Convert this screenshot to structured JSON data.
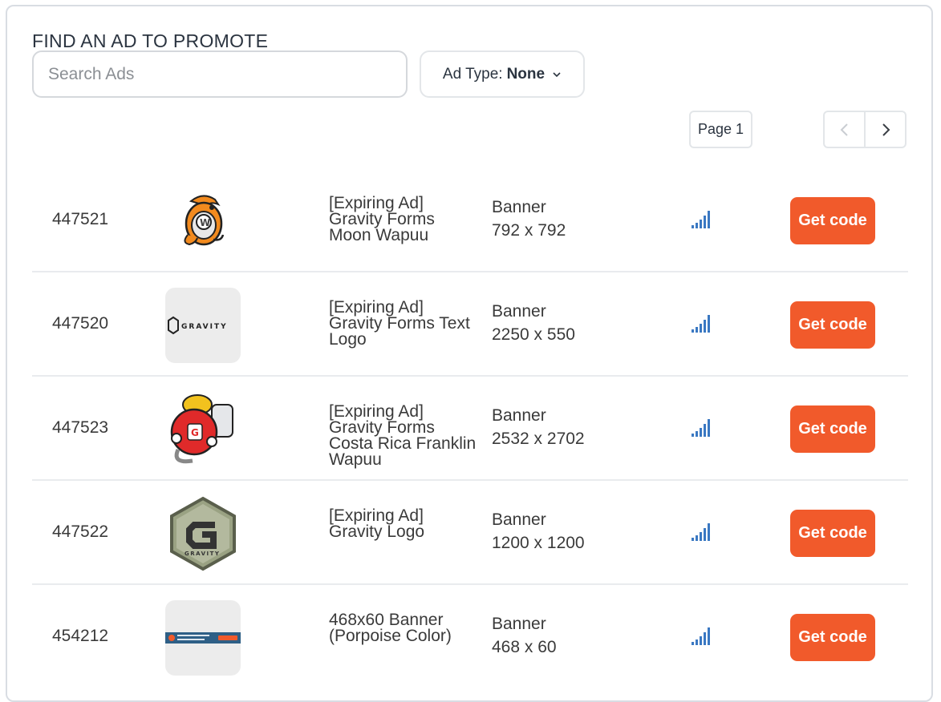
{
  "header": {
    "title": "FIND AN AD TO PROMOTE",
    "search_placeholder": "Search Ads",
    "ad_type_label": "Ad Type:",
    "ad_type_value": "None"
  },
  "pagination": {
    "page_label": "Page 1"
  },
  "colors": {
    "accent": "#f15a2b",
    "signal": "#3a78c2",
    "border": "#d5d8dc"
  },
  "ads": [
    {
      "id": "447521",
      "title": "[Expiring Ad] Gravity Forms Moon Wapuu",
      "type": "Banner",
      "size": "792 x 792",
      "action": "Get code",
      "thumb": "moon-wapuu-icon"
    },
    {
      "id": "447520",
      "title": "[Expiring Ad] Gravity Forms Text Logo",
      "type": "Banner",
      "size": "2250 x 550",
      "action": "Get code",
      "thumb": "gravity-text-logo",
      "logo_text": "GRAVITY"
    },
    {
      "id": "447523",
      "title": "[Expiring Ad] Gravity Forms Costa Rica Franklin Wapuu",
      "type": "Banner",
      "size": "2532 x 2702",
      "action": "Get code",
      "thumb": "franklin-wapuu-icon"
    },
    {
      "id": "447522",
      "title": "[Expiring Ad] Gravity Logo",
      "type": "Banner",
      "size": "1200 x 1200",
      "action": "Get code",
      "thumb": "gravity-hex-logo",
      "logo_text": "GRAVITY"
    },
    {
      "id": "454212",
      "title": "468x60 Banner (Porpoise Color)",
      "type": "Banner",
      "size": "468 x 60",
      "action": "Get code",
      "thumb": "porpoise-banner"
    }
  ]
}
